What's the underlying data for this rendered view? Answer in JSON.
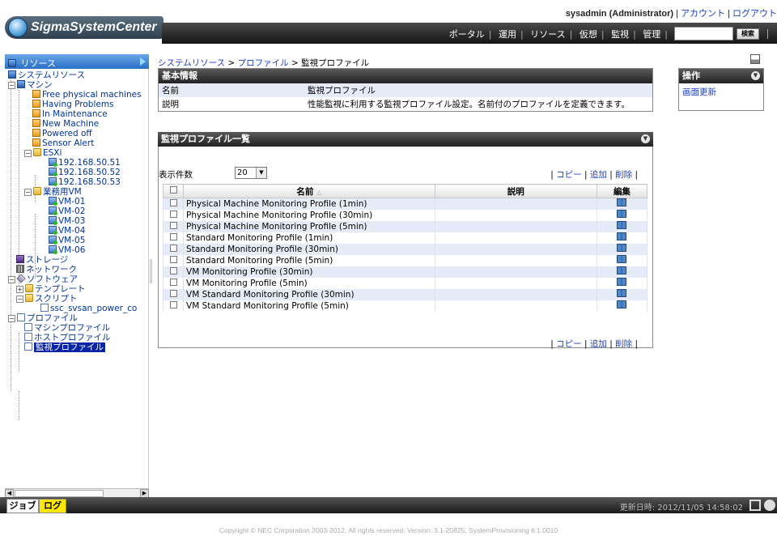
{
  "header": {
    "brand": "SigmaSystemCenter",
    "user": "sysadmin (Administrator)",
    "account_link": "アカウント",
    "logout_link": "ログアウト",
    "menu": [
      "ポータル",
      "運用",
      "リソース",
      "仮想",
      "監視",
      "管理"
    ],
    "search_value": "",
    "search_button": "検索"
  },
  "sidebar": {
    "title": "リソース",
    "tree": {
      "system_resource": "システムリソース",
      "machine": "マシン",
      "free_physical": "Free physical machines",
      "having_problems": "Having Problems",
      "in_maintenance": "In Maintenance",
      "new_machine": "New Machine",
      "powered_off": "Powered off",
      "sensor_alert": "Sensor Alert",
      "esxi": "ESXi",
      "host1": "192.168.50.51",
      "host2": "192.168.50.52",
      "host3": "192.168.50.53",
      "business_vm": "業務用VM",
      "vm1": "VM-01",
      "vm2": "VM-02",
      "vm3": "VM-03",
      "vm4": "VM-04",
      "vm5": "VM-05",
      "vm6": "VM-06",
      "storage": "ストレージ",
      "network": "ネットワーク",
      "software": "ソフトウェア",
      "template": "テンプレート",
      "script": "スクリプト",
      "script_item": "ssc_svsan_power_co",
      "profile": "プロファイル",
      "machine_profile": "マシンプロファイル",
      "host_profile": "ホストプロファイル",
      "monitor_profile": "監視プロファイル"
    }
  },
  "breadcrumb": {
    "part1": "システムリソース",
    "sep": " > ",
    "part2": "プロファイル",
    "current": "監視プロファイル"
  },
  "basic_info": {
    "title": "基本情報",
    "name_label": "名前",
    "name_value": "監視プロファイル",
    "desc_label": "説明",
    "desc_value": "性能監視に利用する監視プロファイル設定。名前付のプロファイルを定義できます。"
  },
  "profile_list": {
    "title": "監視プロファイル一覧",
    "page_size_label": "表示件数",
    "page_size_value": "20",
    "copy": "コピー",
    "add": "追加",
    "delete": "削除",
    "columns": {
      "name": "名前",
      "desc": "説明",
      "edit": "編集"
    },
    "rows": [
      "Physical Machine Monitoring Profile (1min)",
      "Physical Machine Monitoring Profile (30min)",
      "Physical Machine Monitoring Profile (5min)",
      "Standard Monitoring Profile (1min)",
      "Standard Monitoring Profile (30min)",
      "Standard Monitoring Profile (5min)",
      "VM Monitoring Profile (30min)",
      "VM Monitoring Profile (5min)",
      "VM Standard Monitoring Profile (30min)",
      "VM Standard Monitoring Profile (5min)"
    ]
  },
  "operations": {
    "title": "操作",
    "refresh": "画面更新"
  },
  "bottom": {
    "job_tab": "ジョブ",
    "log_tab": "ログ",
    "updated": "更新日時: 2012/11/05 14:58:02"
  },
  "footer": {
    "copyright": "Copyright © NEC Corporation 2003-2012. All rights reserved. Version: 3.1-20825, SystemProvisioning 6.1.0010"
  }
}
